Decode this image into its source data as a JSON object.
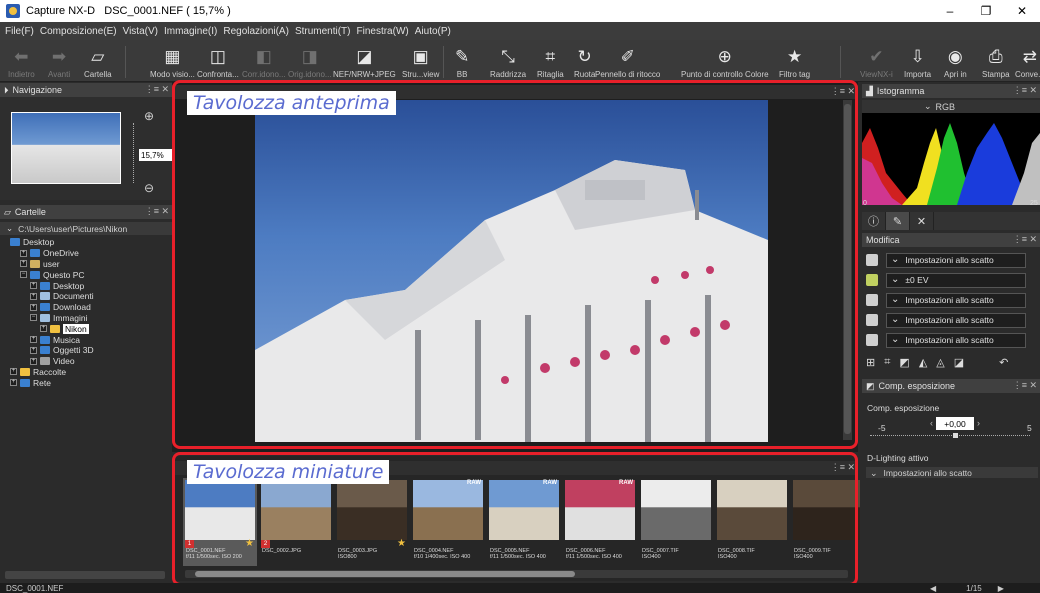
{
  "window": {
    "app_name": "Capture NX-D",
    "document_title": "DSC_0001.NEF ( 15,7% )",
    "controls": [
      "–",
      "❐",
      "✕"
    ]
  },
  "menu": [
    "File(F)",
    "Composizione(E)",
    "Vista(V)",
    "Immagine(I)",
    "Regolazioni(A)",
    "Strumenti(T)",
    "Finestra(W)",
    "Aiuto(P)"
  ],
  "toolbar": {
    "back": "Indietro",
    "forward": "Avanti",
    "folder": "Cartella",
    "view_mode": "Modo visio...",
    "compare": "Confronta...",
    "compare_edit": "Corr.idono...",
    "orig_edit": "Orig.idono...",
    "nef_jpeg": "NEF/NRW+JPEG",
    "status_view": "Stru...view",
    "wb": "BB",
    "straighten": "Raddrizza",
    "crop": "Ritaglia",
    "rotate": "Ruota",
    "retouch": "Pennello di ritocco",
    "control_point": "Punto di controllo Colore",
    "tag_filter": "Filtro tag",
    "viewnx": "ViewNX-i",
    "import": "Importa",
    "open_in": "Apri in",
    "print": "Stampa",
    "convert": "Conve..."
  },
  "navigation": {
    "title": "Navigazione",
    "zoom_value": "15,7%"
  },
  "folders": {
    "title": "Cartelle",
    "path": "C:\\Users\\user\\Pictures\\Nikon",
    "tree": [
      {
        "label": "Desktop",
        "indent": 0,
        "box": "",
        "color": "#3a80d0"
      },
      {
        "label": "OneDrive",
        "indent": 1,
        "box": "+",
        "color": "#3a80d0"
      },
      {
        "label": "user",
        "indent": 1,
        "box": "+",
        "color": "#d0b060"
      },
      {
        "label": "Questo PC",
        "indent": 1,
        "box": "−",
        "color": "#3a80d0"
      },
      {
        "label": "Desktop",
        "indent": 2,
        "box": "+",
        "color": "#3a80d0"
      },
      {
        "label": "Documenti",
        "indent": 2,
        "box": "+",
        "color": "#a0c0e0"
      },
      {
        "label": "Download",
        "indent": 2,
        "box": "+",
        "color": "#3a80d0"
      },
      {
        "label": "Immagini",
        "indent": 2,
        "box": "−",
        "color": "#a0c0e0"
      },
      {
        "label": "Nikon",
        "indent": 3,
        "box": "+",
        "color": "#f0c040",
        "selected": true
      },
      {
        "label": "Musica",
        "indent": 2,
        "box": "+",
        "color": "#3a80d0"
      },
      {
        "label": "Oggetti 3D",
        "indent": 2,
        "box": "+",
        "color": "#3a80d0"
      },
      {
        "label": "Video",
        "indent": 2,
        "box": "+",
        "color": "#a0a0a0"
      },
      {
        "label": "Raccolte",
        "indent": 0,
        "box": "+",
        "color": "#f0c040"
      },
      {
        "label": "Rete",
        "indent": 0,
        "box": "+",
        "color": "#3a80d0"
      }
    ]
  },
  "preview": {
    "callout": "Tavolozza anteprima"
  },
  "thumbnails": {
    "callout": "Tavolozza miniature",
    "items": [
      {
        "name": "DSC_0001.NEF",
        "info": "f/11 1/500sec. ISO 200",
        "raw": false,
        "tag": "1",
        "star": true,
        "selected": true,
        "sky": "#4d7cc2",
        "ground": "#e8e8e8"
      },
      {
        "name": "DSC_0002.JPG",
        "info": "",
        "raw": false,
        "tag": "2",
        "star": false,
        "selected": false,
        "sky": "#8aa8d0",
        "ground": "#9a8060"
      },
      {
        "name": "DSC_0003.JPG",
        "info": "ISO800",
        "raw": false,
        "tag": "",
        "star": true,
        "selected": false,
        "sky": "#6a5a4a",
        "ground": "#3a2e24"
      },
      {
        "name": "DSC_0004.NEF",
        "info": "f/10 1/400sec. ISO 400",
        "raw": true,
        "tag": "",
        "star": false,
        "selected": false,
        "sky": "#9ab8e0",
        "ground": "#8a7050"
      },
      {
        "name": "DSC_0005.NEF",
        "info": "f/11 1/500sec. ISO 400",
        "raw": true,
        "tag": "",
        "star": false,
        "selected": false,
        "sky": "#6f9ad2",
        "ground": "#d8d0c0"
      },
      {
        "name": "DSC_0006.NEF",
        "info": "f/11 1/500sec. ISO 400",
        "raw": true,
        "tag": "",
        "star": false,
        "selected": false,
        "sky": "#c04060",
        "ground": "#e0e0e0"
      },
      {
        "name": "DSC_0007.TIF",
        "info": "ISO400",
        "raw": false,
        "tag": "",
        "star": false,
        "selected": false,
        "sky": "#ececec",
        "ground": "#6a6a6a"
      },
      {
        "name": "DSC_0008.TIF",
        "info": "ISO400",
        "raw": false,
        "tag": "",
        "star": false,
        "selected": false,
        "sky": "#d8d0c0",
        "ground": "#5a4a3a"
      },
      {
        "name": "DSC_0009.TIF",
        "info": "ISO400",
        "raw": false,
        "tag": "",
        "star": false,
        "selected": false,
        "sky": "#5a4a3a",
        "ground": "#2e241c"
      }
    ]
  },
  "histogram": {
    "title": "Istogramma",
    "channel": "RGB",
    "axis_left": "0",
    "axis_right": "25"
  },
  "adjust": {
    "title": "Modifica",
    "rows": [
      "Impostazioni allo scatto",
      "±0 EV",
      "Impostazioni allo scatto",
      "Impostazioni allo scatto",
      "Impostazioni allo scatto"
    ],
    "exposure_panel_title": "Comp. esposizione",
    "exposure_label": "Comp. esposizione",
    "exposure_value": "+0,00",
    "scale_min": "-5",
    "scale_max": "5",
    "dlighting_label": "D-Lighting attivo",
    "dlighting_value": "Impostazioni allo scatto"
  },
  "status": {
    "file": "DSC_0001.NEF",
    "page": "1/15"
  }
}
